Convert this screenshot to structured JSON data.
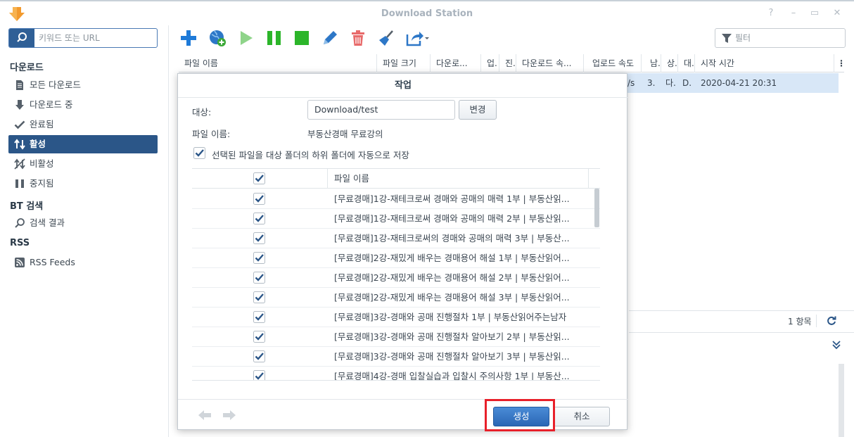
{
  "window": {
    "title": "Download Station"
  },
  "sidebar": {
    "search_placeholder": "키워드 또는 URL",
    "sections": [
      {
        "label": "다운로드"
      },
      {
        "label": "BT 검색"
      },
      {
        "label": "RSS"
      }
    ],
    "items": [
      {
        "label": "모든 다운로드",
        "icon": "document-icon"
      },
      {
        "label": "다운로드 중",
        "icon": "arrow-down-icon"
      },
      {
        "label": "완료됨",
        "icon": "checkmark-icon"
      },
      {
        "label": "활성",
        "icon": "up-down-arrows-icon"
      },
      {
        "label": "비활성",
        "icon": "inactive-icon"
      },
      {
        "label": "중지됨",
        "icon": "pause-icon"
      },
      {
        "label": "검색 결과",
        "icon": "search-icon"
      },
      {
        "label": "RSS Feeds",
        "icon": "rss-icon"
      }
    ]
  },
  "toolbar": {
    "filter_placeholder": "필터"
  },
  "grid": {
    "columns": [
      "파일 이름",
      "파일 크기",
      "다운로...",
      "업.",
      "진.",
      "다운로드 속...",
      "업로드 속도",
      "남.",
      "상.",
      "대.",
      "시작 시간"
    ],
    "row": {
      "speed_tail": "/s",
      "remaining": "3.",
      "status": "다.",
      "dest": "D.",
      "start_time": "2020-04-21 20:31"
    },
    "item_count": "1 항목"
  },
  "dialog": {
    "title": "작업",
    "dest_label": "대상:",
    "dest_value": "Download/test",
    "change_button": "변경",
    "filename_label": "파일 이름:",
    "filename_value": "부동산경매 무료강의",
    "autosave_label": "선택된 파일을 대상 폴더의 하위 폴더에 자동으로 저장",
    "autosave_checked": true,
    "table_header": "파일 이름",
    "files": [
      "[무료경매]1강-재테크로써 경매와 공매의 매력 1부 | 부동산읽...",
      "[무료경매]1강-재테크로써 경매와 공매의 매력 2부 | 부동산읽...",
      "[무료경매]1강-재테크로써의 경매와 공매의 매력 3부 | 부동산...",
      "[무료경매]2강-재밌게 배우는 경매용어 해설 1부 | 부동산읽어...",
      "[무료경매]2강-재밌게 배우는 경매용어 해설 2부 | 부동산읽어...",
      "[무료경매]2강-재밌게 배우는 경매용어 해설 3부 | 부동산읽어...",
      "[무료경매]3강-경매와 공매 진행절차 1부 | 부동산읽어주는남자",
      "[무료경매]3강-경매와 공매 진행절차 알아보기 2부 | 부동산읽...",
      "[무료경매]3강-경매와 공매 진행절차 알아보기 3부 | 부동산읽...",
      "[무료경매]4강-경매 입찰실습과 입찰시 주의사항 1부 | 부동산..."
    ],
    "create_button": "생성",
    "cancel_button": "취소"
  },
  "colors": {
    "accent": "#2b5688",
    "primary_button": "#2a67b5",
    "highlight": "#e8202a",
    "selected_row": "#d8e7f7"
  }
}
